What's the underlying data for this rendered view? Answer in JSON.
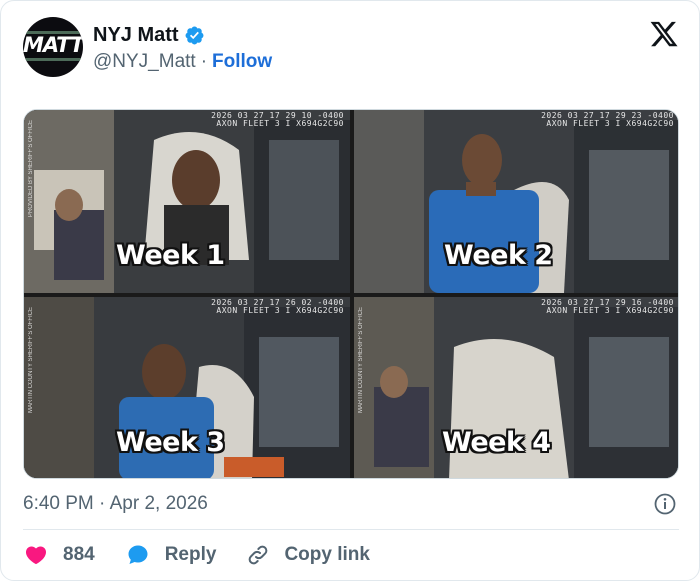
{
  "author": {
    "display_name": "NYJ Matt",
    "handle": "@NYJ_Matt",
    "separator": "·",
    "follow_label": "Follow",
    "avatar_text": "MATT",
    "verified_color": "#1d9bf0"
  },
  "media": {
    "tiles": [
      {
        "label": "Week 1",
        "stamp_line1": "2026 03 27 17 29 10 -0400",
        "stamp_line2": "AXON FLEET 3 I X694G2C90",
        "side_text": "PROVIDED BY SHERIFF'S OFFICE"
      },
      {
        "label": "Week 2",
        "stamp_line1": "2026 03 27 17 29 23 -0400",
        "stamp_line2": "AXON FLEET 3 I X694G2C90",
        "side_text": ""
      },
      {
        "label": "Week 3",
        "stamp_line1": "2026 03 27 17 26 02 -0400",
        "stamp_line2": "AXON FLEET 3 I X694G2C90",
        "side_text": "MARTIN COUNTY SHERIFF'S OFFICE"
      },
      {
        "label": "Week 4",
        "stamp_line1": "2026 03 27 17 29 16 -0400",
        "stamp_line2": "AXON FLEET 3 I X694G2C90",
        "side_text": "MARTIN COUNTY SHERIFF'S OFFICE"
      }
    ]
  },
  "meta": {
    "timestamp": "6:40 PM · Apr 2, 2026"
  },
  "actions": {
    "like_count": "884",
    "reply_label": "Reply",
    "copy_label": "Copy link"
  },
  "colors": {
    "like": "#f91880",
    "reply": "#1d9bf0",
    "link": "#1d6ed8",
    "muted": "#536471"
  },
  "icons": [
    "verified-badge-icon",
    "x-logo-icon",
    "info-icon",
    "heart-icon",
    "reply-bubble-icon",
    "link-icon"
  ]
}
